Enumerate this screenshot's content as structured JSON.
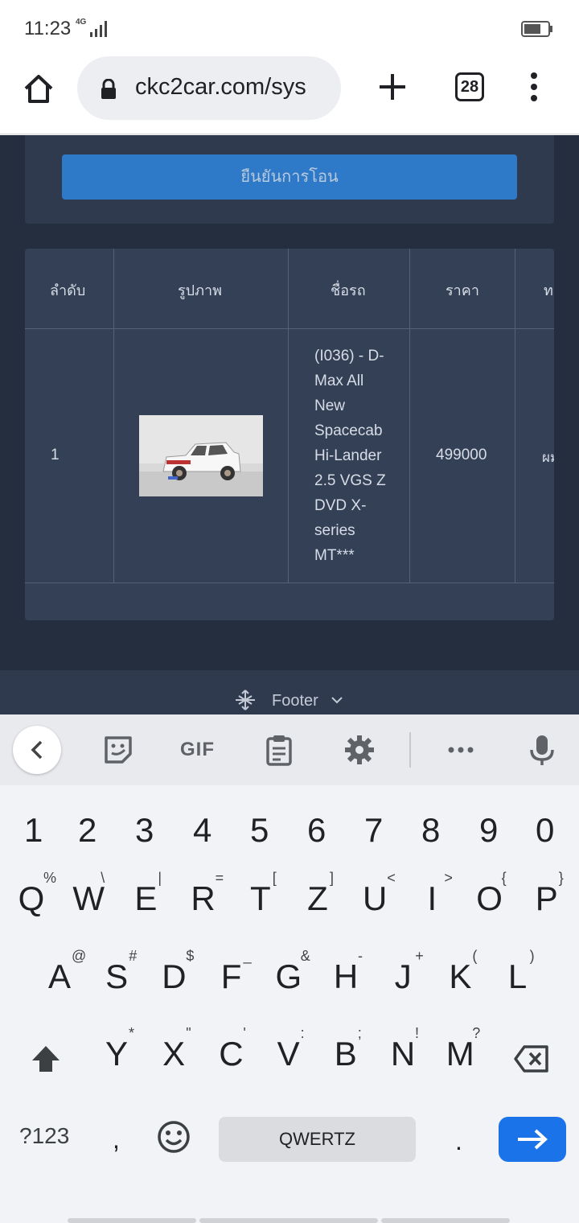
{
  "status": {
    "time": "11:23",
    "network": "4G"
  },
  "browser": {
    "url": "ckc2car.com/sys",
    "tab_count": "28"
  },
  "page": {
    "confirm_button": "ยืนยันการโอน",
    "table": {
      "headers": [
        "ลำดับ",
        "รูปภาพ",
        "ชื่อรถ",
        "ราคา",
        "ท"
      ],
      "rows": [
        {
          "index": "1",
          "image": "pickup-truck-photo",
          "name": "(I036) - D-Max All New Spacecab Hi-Lander 2.5 VGS Z DVD X-series MT***",
          "price": "499000",
          "next_col": "ผม"
        }
      ]
    },
    "footer_label": "Footer"
  },
  "keyboard": {
    "toolbar": {
      "gif": "GIF"
    },
    "numbers": [
      "1",
      "2",
      "3",
      "4",
      "5",
      "6",
      "7",
      "8",
      "9",
      "0"
    ],
    "row1": [
      [
        "Q",
        "%"
      ],
      [
        "W",
        "\\"
      ],
      [
        "E",
        "|"
      ],
      [
        "R",
        "="
      ],
      [
        "T",
        "["
      ],
      [
        "Z",
        "]"
      ],
      [
        "U",
        "<"
      ],
      [
        "I",
        ">"
      ],
      [
        "O",
        "{"
      ],
      [
        "P",
        "}"
      ]
    ],
    "row2": [
      [
        "A",
        "@"
      ],
      [
        "S",
        "#"
      ],
      [
        "D",
        "$"
      ],
      [
        "F",
        "_"
      ],
      [
        "G",
        "&"
      ],
      [
        "H",
        "-"
      ],
      [
        "J",
        "+"
      ],
      [
        "K",
        "("
      ],
      [
        "L",
        ")"
      ]
    ],
    "row3": [
      [
        "Y",
        "*"
      ],
      [
        "X",
        "\""
      ],
      [
        "C",
        "'"
      ],
      [
        "V",
        ":"
      ],
      [
        "B",
        ";"
      ],
      [
        "N",
        "!"
      ],
      [
        "M",
        "?"
      ]
    ],
    "symbols": "?123",
    "comma": ",",
    "space": "QWERTZ",
    "period": "."
  },
  "colors": {
    "page_bg": "#252e3f",
    "card": "#2f3a4f",
    "accent": "#2e7ac8",
    "enter": "#1a73e8"
  }
}
